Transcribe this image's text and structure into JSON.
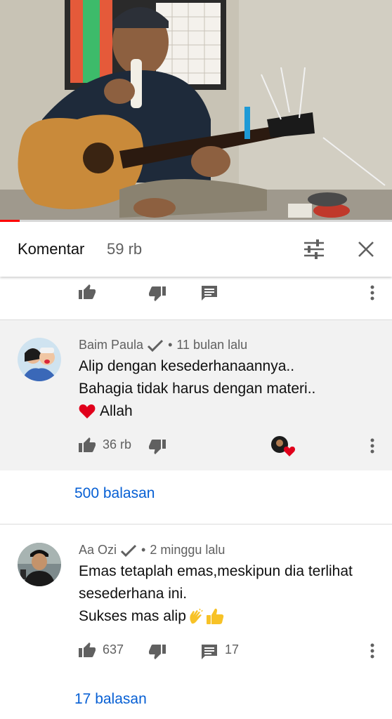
{
  "video": {
    "progress_fraction": 0.05
  },
  "header": {
    "title": "Komentar",
    "count": "59 rb"
  },
  "comments": [
    {
      "author": "Baim Paula",
      "verified": true,
      "separator": "•",
      "time": "11 bulan lalu",
      "lines": [
        "Alip dengan kesederhanaannya..",
        "Bahagia tidak harus dengan materi..",
        "Allah"
      ],
      "likes": "36 rb",
      "replies_label": "500 balasan"
    },
    {
      "author": "Aa Ozi",
      "verified": true,
      "separator": "•",
      "time": "2 minggu lalu",
      "lines": [
        "Emas tetaplah emas,meskipun dia terlihat",
        "sesederhana ini.",
        "Sukses mas alip"
      ],
      "likes": "637",
      "reply_count": "17",
      "replies_label": "17 balasan"
    }
  ],
  "colors": {
    "accent_link": "#065fd4",
    "progress": "#ff0000",
    "heart": "#e0001b"
  },
  "icons": [
    "thumb-up-icon",
    "thumb-down-icon",
    "comment-icon",
    "more-vert-icon",
    "filter-icon",
    "close-icon",
    "verified-check-icon",
    "heart-emoji",
    "clapping-hands-emoji",
    "thumbs-up-emoji"
  ]
}
